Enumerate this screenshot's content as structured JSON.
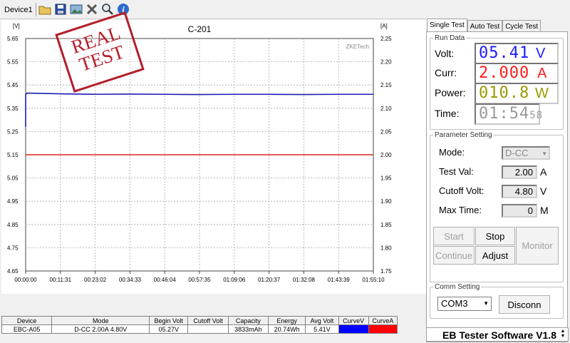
{
  "toolbar": {
    "device_tab": "Device1",
    "icons": [
      "open-folder-icon",
      "save-icon",
      "image-icon",
      "tools-icon",
      "zoom-icon",
      "info-icon"
    ]
  },
  "stamp": {
    "line1": "REAL",
    "line2": "TEST"
  },
  "chart": {
    "title": "C-201",
    "left_unit": "[V]",
    "right_unit": "[A]",
    "watermark": "ZKETech",
    "left_ticks": [
      "5.65",
      "5.55",
      "5.45",
      "5.35",
      "5.25",
      "5.15",
      "5.05",
      "4.95",
      "4.85",
      "4.75",
      "4.65"
    ],
    "right_ticks": [
      "2.25",
      "2.20",
      "2.15",
      "2.10",
      "2.05",
      "2.00",
      "1.95",
      "1.90",
      "1.85",
      "1.80",
      "1.75"
    ],
    "x_ticks": [
      "00:00:00",
      "00:11:31",
      "00:23:02",
      "00:34:33",
      "00:46:04",
      "00:57:35",
      "01:09:06",
      "01:20:37",
      "01:32:08",
      "01:43:39",
      "01:55:10"
    ]
  },
  "chart_data": {
    "type": "line",
    "title": "C-201",
    "xlabel": "",
    "ylabel": "[V]",
    "y2label": "[A]",
    "ylim": [
      4.65,
      5.65
    ],
    "y2lim": [
      1.75,
      2.25
    ],
    "xlim": [
      "00:00:00",
      "01:55:10"
    ],
    "grid": true,
    "series": [
      {
        "axis": "left",
        "color": "#1c1cb4",
        "x": [
          "00:00:00",
          "00:00:00",
          "00:00:30",
          "00:11:31",
          "00:23:02",
          "00:34:33",
          "00:46:04",
          "00:57:35",
          "01:09:06",
          "01:20:37",
          "01:32:08",
          "01:43:39",
          "01:55:10"
        ],
        "values": [
          5.27,
          5.41,
          5.415,
          5.412,
          5.41,
          5.411,
          5.41,
          5.409,
          5.41,
          5.41,
          5.409,
          5.41,
          5.41
        ]
      },
      {
        "axis": "right",
        "color": "#e02020",
        "x": [
          "00:00:00",
          "01:55:10"
        ],
        "values": [
          2.0,
          2.0
        ]
      }
    ]
  },
  "tabs": [
    "Single Test",
    "Auto Test",
    "Cycle Test"
  ],
  "run_data": {
    "legend": "Run Data",
    "volt_label": "Volt:",
    "volt_value": "05.41",
    "volt_unit": "V",
    "curr_label": "Curr:",
    "curr_value": "2.000",
    "curr_unit": "A",
    "power_label": "Power:",
    "power_value": "010.8",
    "power_unit": "W",
    "time_label": "Time:",
    "time_value": "01:54",
    "time_seconds": "58",
    "colors": {
      "volt": "#1a1aff",
      "curr": "#ff1a1a",
      "power": "#999900",
      "time": "#9a9a9a"
    }
  },
  "param": {
    "legend": "Parameter Setting",
    "mode_label": "Mode:",
    "mode_value": "D-CC",
    "testval_label": "Test Val:",
    "testval_value": "2.00",
    "testval_unit": "A",
    "cutoff_label": "Cutoff Volt:",
    "cutoff_value": "4.80",
    "cutoff_unit": "V",
    "maxtime_label": "Max Time:",
    "maxtime_value": "0",
    "maxtime_unit": "M",
    "buttons": {
      "start": "Start",
      "stop": "Stop",
      "continue": "Continue",
      "adjust": "Adjust",
      "monitor": "Monitor"
    }
  },
  "comm": {
    "legend": "Comm Setting",
    "port": "COM3",
    "disconn": "Disconn"
  },
  "table": {
    "headers": [
      "Device",
      "Mode",
      "Begin Volt",
      "Cutoff Volt",
      "Capacity",
      "Energy",
      "Avg Volt",
      "CurveV",
      "CurveA"
    ],
    "row": [
      "EBC-A05",
      "D-CC  2.00A  4.80V",
      "05.27V",
      "",
      "3833mAh",
      "20.74Wh",
      "5.41V"
    ],
    "curve_colors": [
      "#0000ff",
      "#ff0000"
    ]
  },
  "footer": {
    "title": "EB Tester Software V1.8"
  }
}
